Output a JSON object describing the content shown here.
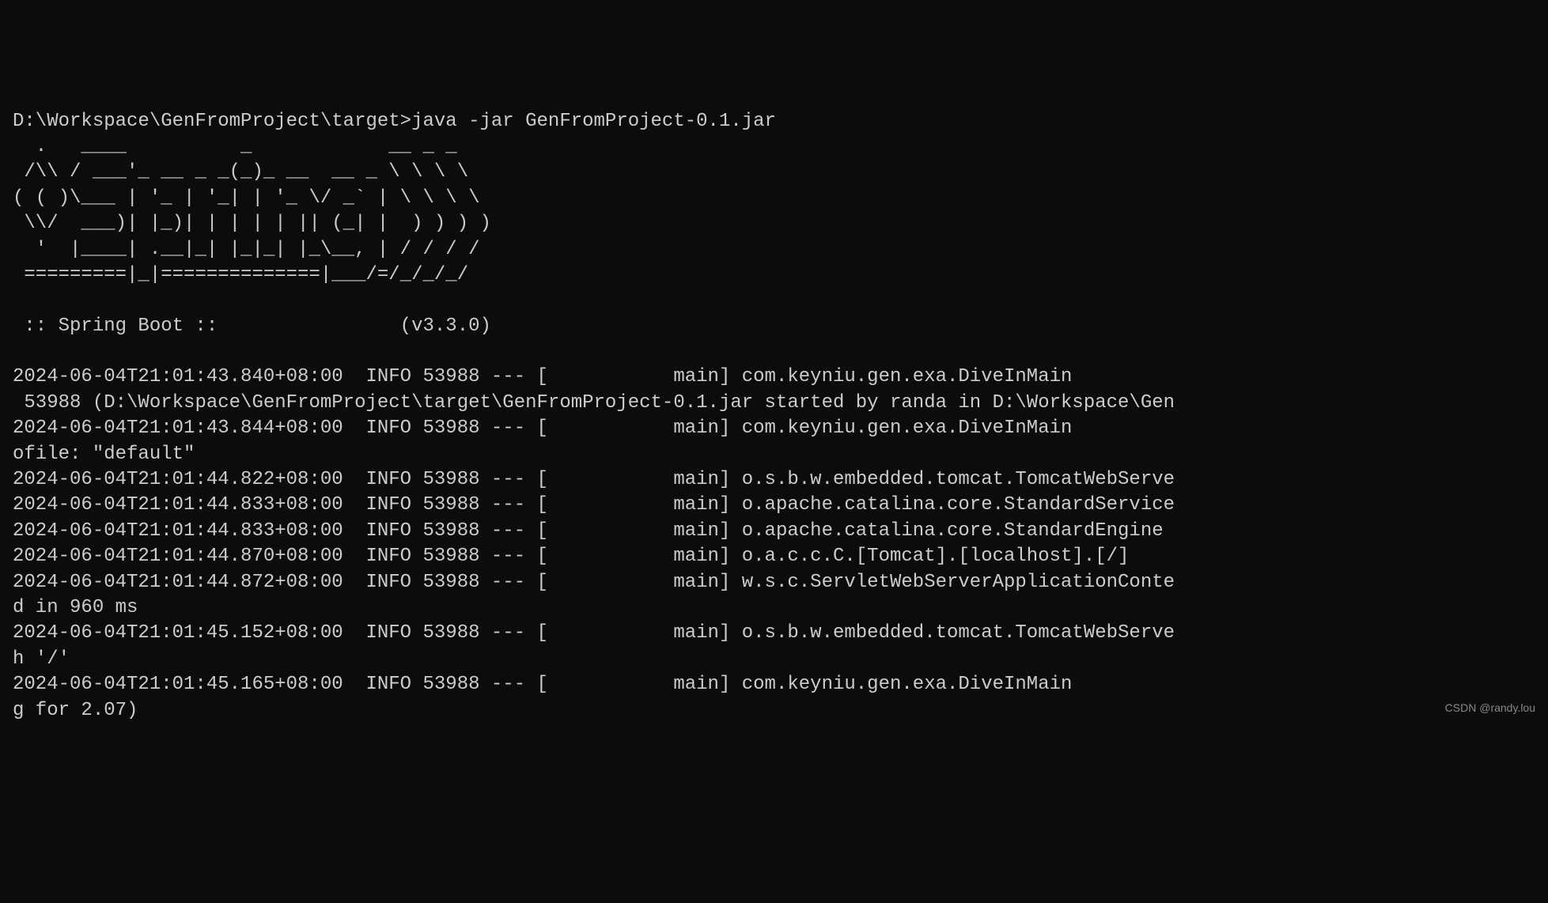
{
  "prompt": "D:\\Workspace\\GenFromProject\\target>java -jar GenFromProject-0.1.jar",
  "banner": "  .   ____          _            __ _ _\n /\\\\ / ___'_ __ _ _(_)_ __  __ _ \\ \\ \\ \\\n( ( )\\___ | '_ | '_| | '_ \\/ _` | \\ \\ \\ \\\n \\\\/  ___)| |_)| | | | | || (_| |  ) ) ) )\n  '  |____| .__|_| |_|_| |_\\__, | / / / /\n =========|_|==============|___/=/_/_/_/",
  "spring_boot_line": " :: Spring Boot ::                (v3.3.0)",
  "log_lines": [
    "2024-06-04T21:01:43.840+08:00  INFO 53988 --- [           main] com.keyniu.gen.exa.DiveInMain",
    " 53988 (D:\\Workspace\\GenFromProject\\target\\GenFromProject-0.1.jar started by randa in D:\\Workspace\\Gen",
    "2024-06-04T21:01:43.844+08:00  INFO 53988 --- [           main] com.keyniu.gen.exa.DiveInMain",
    "ofile: \"default\"",
    "2024-06-04T21:01:44.822+08:00  INFO 53988 --- [           main] o.s.b.w.embedded.tomcat.TomcatWebServe",
    "2024-06-04T21:01:44.833+08:00  INFO 53988 --- [           main] o.apache.catalina.core.StandardService",
    "2024-06-04T21:01:44.833+08:00  INFO 53988 --- [           main] o.apache.catalina.core.StandardEngine",
    "2024-06-04T21:01:44.870+08:00  INFO 53988 --- [           main] o.a.c.c.C.[Tomcat].[localhost].[/]",
    "2024-06-04T21:01:44.872+08:00  INFO 53988 --- [           main] w.s.c.ServletWebServerApplicationConte",
    "d in 960 ms",
    "2024-06-04T21:01:45.152+08:00  INFO 53988 --- [           main] o.s.b.w.embedded.tomcat.TomcatWebServe",
    "h '/'",
    "2024-06-04T21:01:45.165+08:00  INFO 53988 --- [           main] com.keyniu.gen.exa.DiveInMain",
    "g for 2.07)"
  ],
  "watermark": "CSDN @randy.lou"
}
